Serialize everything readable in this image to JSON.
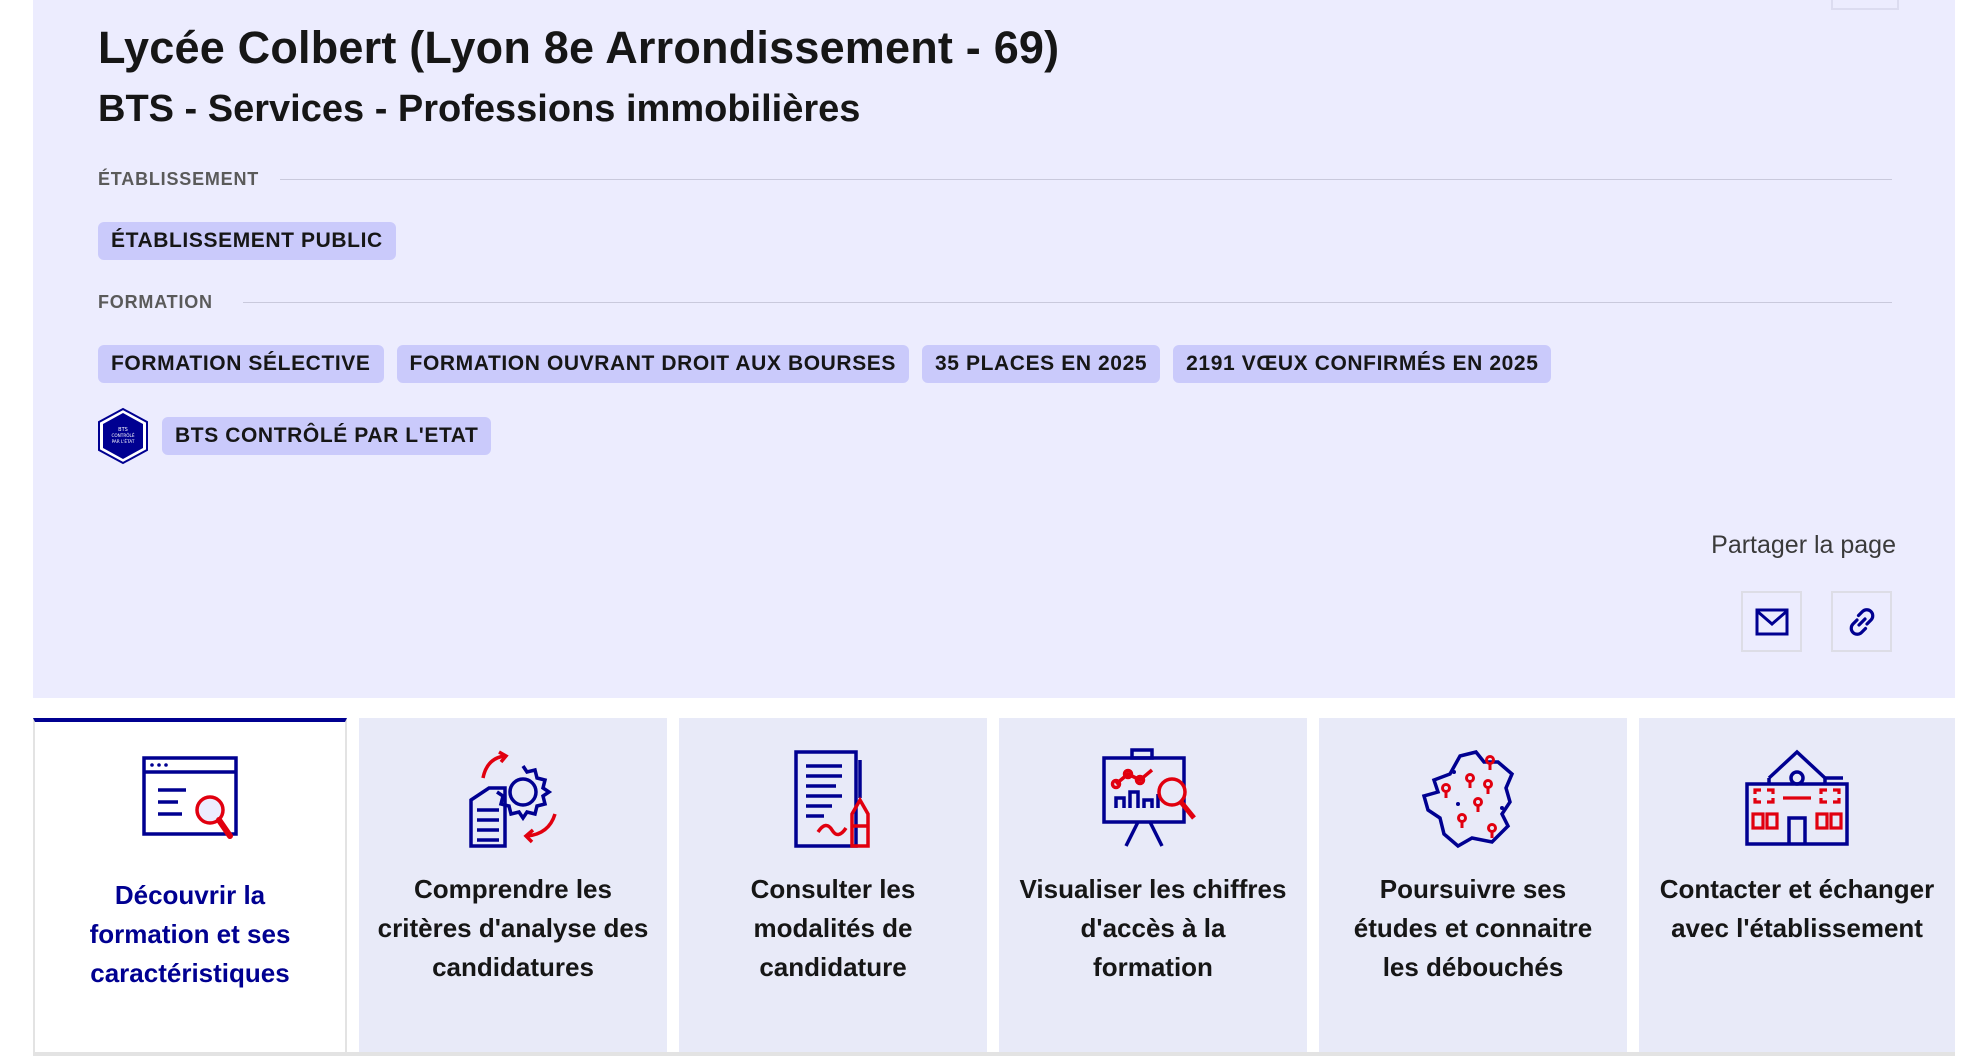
{
  "header": {
    "title": "Lycée Colbert (Lyon 8e Arrondissement - 69)",
    "subtitle": "BTS - Services - Professions immobilières"
  },
  "establishment": {
    "label": "ÉTABLISSEMENT",
    "tags": [
      "ÉTABLISSEMENT PUBLIC"
    ]
  },
  "formation": {
    "label": "FORMATION",
    "tags": [
      "FORMATION SÉLECTIVE",
      "FORMATION OUVRANT DROIT AUX BOURSES",
      "35 PLACES EN 2025",
      "2191 VŒUX CONFIRMÉS EN 2025"
    ],
    "bts_badge": {
      "label": "BTS CONTRÔLÉ PAR L'ETAT",
      "icon": "bts-controle-etat-icon",
      "icon_text": [
        "BTS",
        "CONTRÔLÉ",
        "PAR L'ÉTAT"
      ]
    }
  },
  "share": {
    "label": "Partager la page",
    "buttons": [
      {
        "name": "share-email-button",
        "icon": "mail-icon"
      },
      {
        "name": "share-link-button",
        "icon": "link-icon"
      }
    ]
  },
  "tabs": [
    {
      "label": "Découvrir la formation et ses caractéristiques",
      "icon": "browser-search-icon",
      "active": true
    },
    {
      "label": "Comprendre les critères d'analyse des candidatures",
      "icon": "document-gear-icon",
      "active": false
    },
    {
      "label": "Consulter les modalités de candidature",
      "icon": "document-pen-icon",
      "active": false
    },
    {
      "label": "Visualiser les chiffres d'accès à la formation",
      "icon": "chart-board-icon",
      "active": false
    },
    {
      "label": "Poursuivre ses études et connaitre les débouchés",
      "icon": "france-map-icon",
      "active": false
    },
    {
      "label": "Contacter et échanger avec l'établissement",
      "icon": "school-building-icon",
      "active": false
    }
  ],
  "colors": {
    "primary_blue": "#000091",
    "accent_red": "#e1000f",
    "hero_background": "#ececfe",
    "tag_background": "#cacafb",
    "tile_background": "#e8eaf8"
  }
}
